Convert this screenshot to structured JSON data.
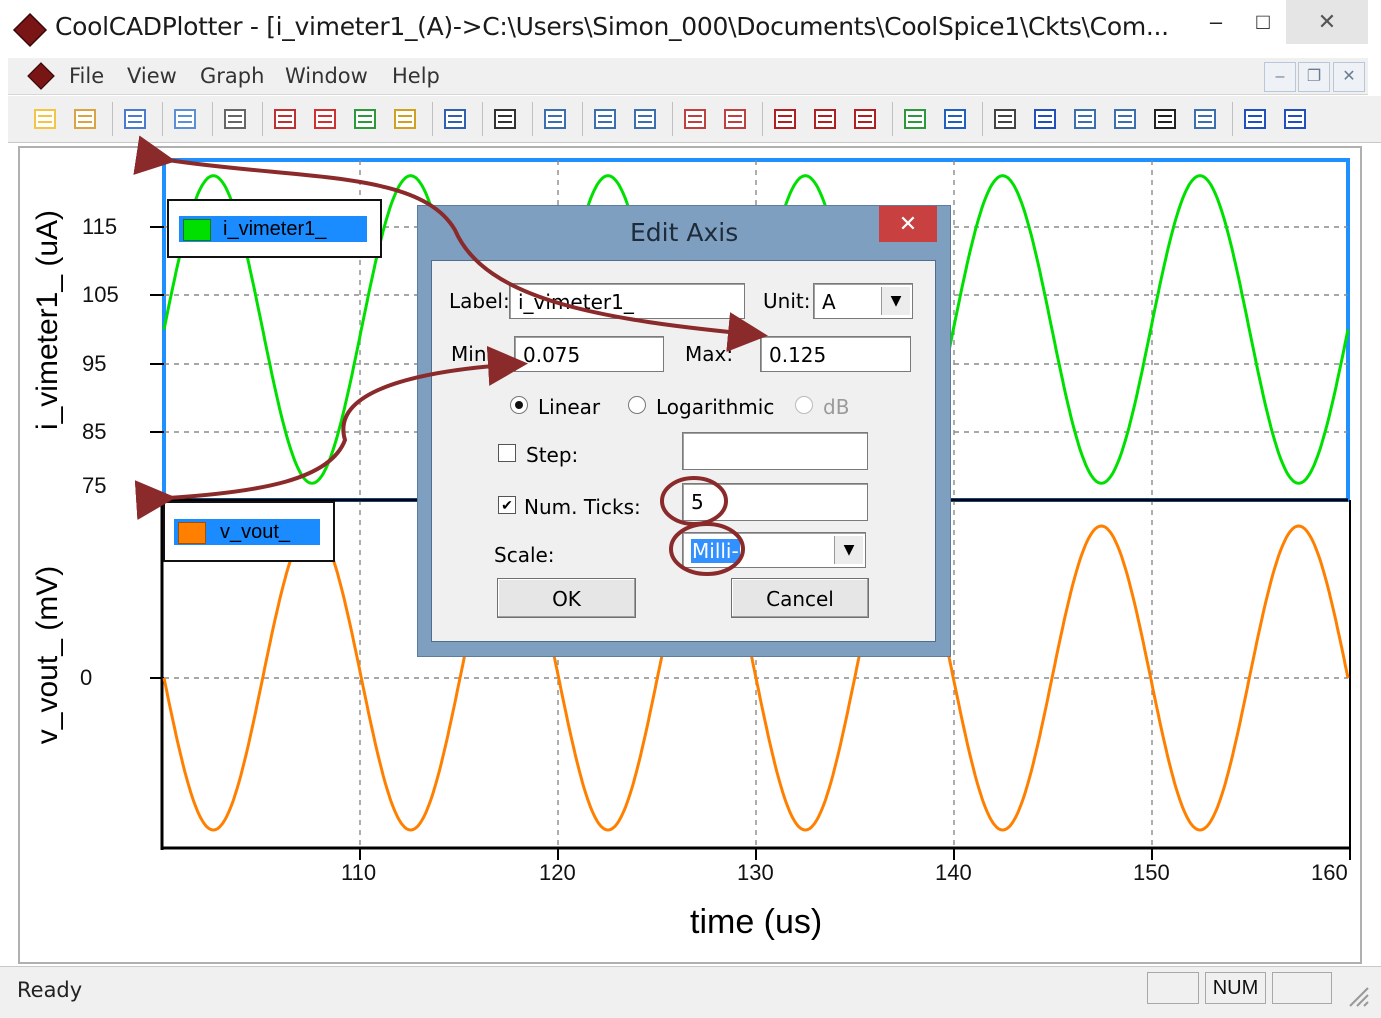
{
  "window": {
    "title": "CoolCADPlotter - [i_vimeter1_(A)->C:\\Users\\Simon_000\\Documents\\CoolSpice1\\Ckts\\Com...",
    "min_glyph": "–",
    "max_glyph": "□",
    "close_glyph": "✕"
  },
  "menu": {
    "items": [
      "File",
      "View",
      "Graph",
      "Window",
      "Help"
    ],
    "mdi_min": "–",
    "mdi_restore": "❐",
    "mdi_close": "✕"
  },
  "toolbar": {
    "icons": [
      "new-icon",
      "open-icon",
      "table-icon",
      "copy-icon",
      "print-icon",
      "plot-icon",
      "plot-red-icon",
      "plot-multi-icon",
      "plot-color-icon",
      "calculator-icon",
      "function-icon",
      "zoom-box-icon",
      "zoom-in-icon",
      "zoom-out-icon",
      "zoom-fit-icon",
      "zoom-prev-icon",
      "cursor-x-icon",
      "cursor-grid-icon",
      "cursor-cross-icon",
      "export-icon",
      "arrow-icon",
      "chart-icon",
      "grid-icon",
      "list-icon",
      "page-icon",
      "gradient-icon",
      "properties-icon",
      "split-icon",
      "panel-icon"
    ]
  },
  "status": {
    "ready": "Ready",
    "num": "NUM"
  },
  "chart_data": [
    {
      "type": "line",
      "title": "",
      "ylabel": "i_vimeter1_  (uA)",
      "xlabel": "time (us)",
      "yticks": [
        "115",
        "105",
        "95",
        "85",
        "75"
      ],
      "ylim": [
        75,
        125
      ],
      "xlim": [
        100,
        160
      ],
      "grid": true,
      "legend": "top-left",
      "series": [
        {
          "name": "i_vimeter1_",
          "color": "#00e000",
          "function": "sine",
          "offset": 100,
          "amplitude": 22.5,
          "period_us": 10,
          "phase_deg": 0
        }
      ]
    },
    {
      "type": "line",
      "title": "",
      "ylabel": "v_vout_  (mV)",
      "xlabel": "time (us)",
      "xticks": [
        "110",
        "120",
        "130",
        "140",
        "150",
        "160"
      ],
      "yticks": [
        "0"
      ],
      "xlim": [
        100,
        160
      ],
      "grid": true,
      "legend": "top-left",
      "series": [
        {
          "name": "v_vout_",
          "color": "#ff8000",
          "function": "sine",
          "offset": 0,
          "amplitude": 1,
          "period_us": 10,
          "phase_deg": 180
        }
      ]
    }
  ],
  "dialog": {
    "title": "Edit Axis",
    "close_glyph": "✕",
    "label_caption": "Label:",
    "label_value": "i_vimeter1_",
    "unit_caption": "Unit:",
    "unit_value": "A",
    "min_caption": "Min:",
    "min_value": "0.075",
    "max_caption": "Max:",
    "max_value": "0.125",
    "radio_linear": "Linear",
    "radio_log": "Logarithmic",
    "radio_db": "dB",
    "step_caption": "Step:",
    "step_value": "",
    "numticks_caption": "Num. Ticks:",
    "numticks_value": "5",
    "scale_caption": "Scale:",
    "scale_value": "Milli-",
    "ok_label": "OK",
    "cancel_label": "Cancel",
    "check_glyph": "✔",
    "arrow_glyph": "▼"
  },
  "annotation_color": "#8b2a2a"
}
